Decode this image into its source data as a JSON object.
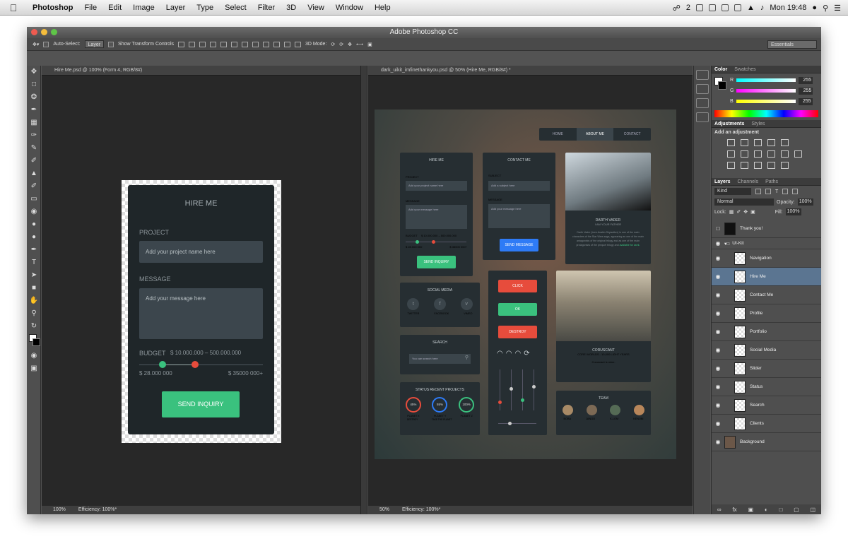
{
  "menubar": {
    "apple": "",
    "app": "Photoshop",
    "items": [
      "File",
      "Edit",
      "Image",
      "Layer",
      "Type",
      "Select",
      "Filter",
      "3D",
      "View",
      "Window",
      "Help"
    ],
    "badge": "2",
    "clock": "Mon 19:48"
  },
  "window": {
    "title": "Adobe Photoshop CC"
  },
  "options": {
    "auto_select": "Auto-Select:",
    "layer_select": "Layer",
    "show_transform": "Show Transform Controls",
    "mode3d": "3D Mode:",
    "workspace": "Essentials"
  },
  "doc1": {
    "tab": "Hire Me.psd @ 100% (Form 4, RGB/8#)",
    "zoom": "100%",
    "efficiency": "Efficiency: 100%*",
    "hire": {
      "title": "HIRE ME",
      "project_label": "PROJECT",
      "project_placeholder": "Add your project name here",
      "message_label": "MESSAGE",
      "message_placeholder": "Add your message here",
      "budget_label": "BUDGET",
      "budget_range": "$ 10.000.000 – 500.000.000",
      "min": "$ 28.000 000",
      "max": "$ 35000 000+",
      "button": "SEND INQUIRY"
    }
  },
  "doc2": {
    "tab": "dark_uikit_imfinethankyou.psd @ 50% (Hire Me, RGB/8#) *",
    "zoom": "50%",
    "efficiency": "Efficiency: 100%*",
    "nav": [
      "HOME",
      "ABOUT ME",
      "CONTACT"
    ],
    "hire": {
      "title": "HIRE ME",
      "project": "PROJECT",
      "project_ph": "Add your project name here",
      "message": "MESSAGE",
      "message_ph": "Add your message here",
      "budget": "BUDGET",
      "range": "$ 10.000.000 – 500.000.000",
      "min": "$ 28.000 000",
      "max": "$ 35000 000+",
      "button": "SEND INQUIRY"
    },
    "contact": {
      "title": "CONTACT ME",
      "subject": "SUBJECT",
      "subject_ph": "Add a subject here",
      "message": "MESSAGE",
      "message_ph": "Add your message here",
      "button": "SEND MESSAGE"
    },
    "vader": {
      "name": "DARTH VADER",
      "sub": "I AM YOUR FATHER",
      "bio": "Darth Vader (born Anakin Skywalker) is one of the main characters of the Star Wars saga, appearing as one of the main antagonists of the original trilogy and as one of the main protagonists of the prequel trilogy and",
      "bio_link": "available for work."
    },
    "social": {
      "title": "SOCIAL MEDIA",
      "items": [
        "TWITTER",
        "FACEBOOK",
        "VIMEO"
      ]
    },
    "buttons": {
      "click": "CLICK",
      "ok": "OK",
      "destroy": "DESTROY"
    },
    "coruscant": {
      "name": "CORUSCANT",
      "sub": "CORE WORLDS - 10,000 LIGHT YEARS",
      "desc": "Coruscant is mine."
    },
    "search": {
      "title": "SEARCH",
      "placeholder": "You can search here"
    },
    "status": {
      "title": "STATUS RECENT PROJECTS",
      "projects": [
        {
          "pct": "45%",
          "name": "PLANET X",
          "note": "DESTROY"
        },
        {
          "pct": "55%",
          "name": "PLANET Y",
          "note": "TAKE THE PLANET"
        },
        {
          "pct": "100%",
          "name": "PLANET Z",
          "note": ""
        }
      ]
    },
    "team": {
      "title": "TEAM",
      "members": [
        "BOBA",
        "JANGO",
        "K-LOM",
        "KENOBI"
      ]
    }
  },
  "color_panel": {
    "tabs": [
      "Color",
      "Swatches"
    ],
    "channels": [
      {
        "n": "R",
        "v": "255"
      },
      {
        "n": "G",
        "v": "255"
      },
      {
        "n": "B",
        "v": "255"
      }
    ]
  },
  "adjust_panel": {
    "tabs": [
      "Adjustments",
      "Styles"
    ],
    "heading": "Add an adjustment"
  },
  "layers_panel": {
    "tabs": [
      "Layers",
      "Channels",
      "Paths"
    ],
    "kind": "Kind",
    "blend": "Normal",
    "opacity_label": "Opacity:",
    "opacity": "100%",
    "lock_label": "Lock:",
    "fill_label": "Fill:",
    "fill": "100%",
    "layers": [
      "Thank you!",
      "UI-Kit",
      "Navigation",
      "Hire Me",
      "Contact Me",
      "Profile",
      "Portfolio",
      "Social Media",
      "Slider",
      "Status",
      "Search",
      "Clients",
      "Background"
    ]
  }
}
